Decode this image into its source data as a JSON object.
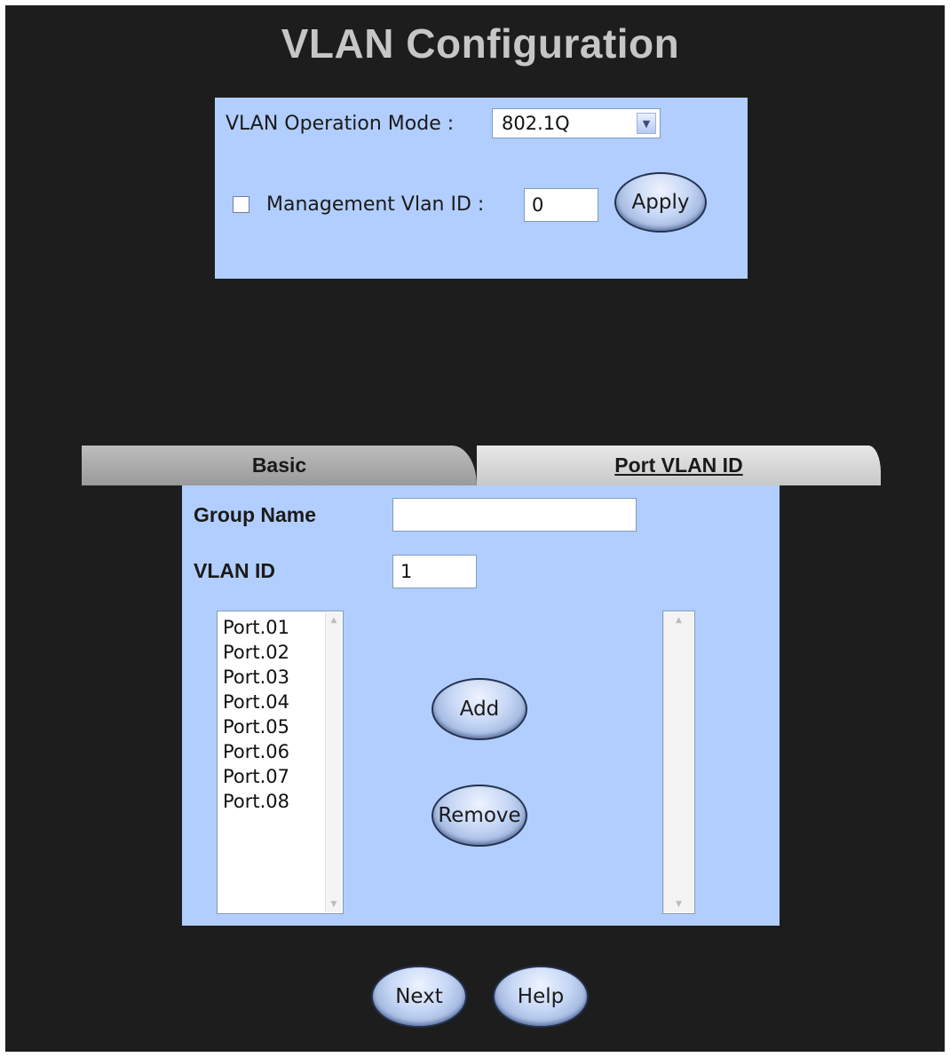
{
  "title": "VLAN Configuration",
  "top_panel": {
    "mode_label": "VLAN Operation Mode :",
    "mode_value": "802.1Q",
    "mgmt_label": "Management Vlan ID :",
    "mgmt_value": "0",
    "apply_label": "Apply"
  },
  "tabs": [
    {
      "label": "Basic"
    },
    {
      "label": "Port VLAN ID"
    }
  ],
  "form": {
    "group_name_label": "Group Name",
    "group_name_value": "",
    "vlan_id_label": "VLAN ID",
    "vlan_id_value": "1"
  },
  "available_ports": [
    "Port.01",
    "Port.02",
    "Port.03",
    "Port.04",
    "Port.05",
    "Port.06",
    "Port.07",
    "Port.08"
  ],
  "buttons": {
    "add": "Add",
    "remove": "Remove",
    "next": "Next",
    "help": "Help"
  },
  "icons": {
    "select_arrow": "chevron-down-icon",
    "scroll_up": "arrow-up-icon",
    "scroll_down": "arrow-down-icon"
  }
}
